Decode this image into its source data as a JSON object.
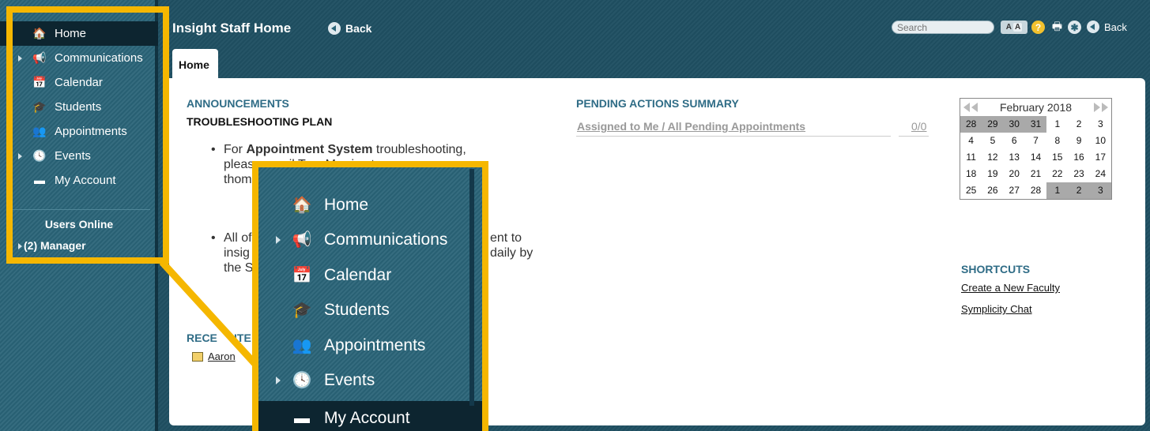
{
  "sidebar": {
    "items": [
      {
        "label": "Home",
        "icon": "home-icon",
        "glyph": "🏠"
      },
      {
        "label": "Communications",
        "icon": "megaphone-icon",
        "glyph": "📢"
      },
      {
        "label": "Calendar",
        "icon": "calendar-icon",
        "glyph": "📅"
      },
      {
        "label": "Students",
        "icon": "graduation-cap-icon",
        "glyph": "🎓"
      },
      {
        "label": "Appointments",
        "icon": "people-icon",
        "glyph": "👥"
      },
      {
        "label": "Events",
        "icon": "clock-icon",
        "glyph": "🕓"
      },
      {
        "label": "My Account",
        "icon": "id-card-icon",
        "glyph": "▬"
      }
    ],
    "users_online_title": "Users Online",
    "users_online_item": "(2) Manager"
  },
  "header": {
    "title": "Insight Staff Home",
    "back_label": "Back",
    "search_placeholder": "Search",
    "font_size_small": "A",
    "font_size_large": "A",
    "help_glyph": "?",
    "print_glyph": "🖶",
    "accessibility_glyph": "✱",
    "right_back_label": "Back"
  },
  "tabs": [
    {
      "label": "Home"
    }
  ],
  "announcements": {
    "title": "ANNOUNCEMENTS",
    "subtitle": "TROUBLESHOOTING PLAN",
    "bullet1_prefix": "For ",
    "bullet1_bold": "Appointment System",
    "bullet1_suffix": " troubleshooting,",
    "bullet1_line2": "please email Tom Morris at",
    "bullet1_line3": "thom",
    "bullet2_line1": "All of",
    "bullet2_line1_end": "ent to",
    "bullet2_line2": "insig",
    "bullet2_line2_end": "daily by",
    "bullet2_line3": "the S"
  },
  "pending": {
    "title": "PENDING ACTIONS SUMMARY",
    "link": "Assigned to Me / All Pending Appointments",
    "count": "0/0"
  },
  "recent": {
    "title": "RECENT ITEMS",
    "title_visible": "RECE",
    "title_visible_end": "ITE",
    "item": "Aaron"
  },
  "calendar": {
    "month_label": "February 2018",
    "weeks": [
      [
        {
          "d": "28",
          "other": true
        },
        {
          "d": "29",
          "other": true
        },
        {
          "d": "30",
          "other": true
        },
        {
          "d": "31",
          "other": true
        },
        {
          "d": "1",
          "other": false
        },
        {
          "d": "2",
          "other": false
        },
        {
          "d": "3",
          "other": false
        }
      ],
      [
        {
          "d": "4",
          "other": false
        },
        {
          "d": "5",
          "other": false
        },
        {
          "d": "6",
          "other": false
        },
        {
          "d": "7",
          "other": false
        },
        {
          "d": "8",
          "other": false
        },
        {
          "d": "9",
          "other": false
        },
        {
          "d": "10",
          "other": false
        }
      ],
      [
        {
          "d": "11",
          "other": false
        },
        {
          "d": "12",
          "other": false
        },
        {
          "d": "13",
          "other": false
        },
        {
          "d": "14",
          "other": false
        },
        {
          "d": "15",
          "other": false
        },
        {
          "d": "16",
          "other": false
        },
        {
          "d": "17",
          "other": false
        }
      ],
      [
        {
          "d": "18",
          "other": false
        },
        {
          "d": "19",
          "other": false
        },
        {
          "d": "20",
          "other": false
        },
        {
          "d": "21",
          "other": false
        },
        {
          "d": "22",
          "other": false
        },
        {
          "d": "23",
          "other": false
        },
        {
          "d": "24",
          "other": false
        }
      ],
      [
        {
          "d": "25",
          "other": false
        },
        {
          "d": "26",
          "other": false
        },
        {
          "d": "27",
          "other": false
        },
        {
          "d": "28",
          "other": false
        },
        {
          "d": "1",
          "other": true
        },
        {
          "d": "2",
          "other": true
        },
        {
          "d": "3",
          "other": true
        }
      ]
    ]
  },
  "shortcuts": {
    "title": "SHORTCUTS",
    "items": [
      "Create a New Faculty",
      "Symplicity Chat"
    ]
  },
  "zoom": {
    "items": [
      {
        "label": "Home",
        "icon": "home-icon",
        "glyph": "🏠"
      },
      {
        "label": "Communications",
        "icon": "megaphone-icon",
        "glyph": "📢"
      },
      {
        "label": "Calendar",
        "icon": "calendar-icon",
        "glyph": "📅"
      },
      {
        "label": "Students",
        "icon": "graduation-cap-icon",
        "glyph": "🎓"
      },
      {
        "label": "Appointments",
        "icon": "people-icon",
        "glyph": "👥"
      },
      {
        "label": "Events",
        "icon": "clock-icon",
        "glyph": "🕓"
      },
      {
        "label": "My Account",
        "icon": "id-card-icon",
        "glyph": "▬"
      }
    ]
  },
  "colors": {
    "highlight": "#f5b700",
    "sidebar_bg": "#2a6478",
    "accent_text": "#2f6c86"
  }
}
